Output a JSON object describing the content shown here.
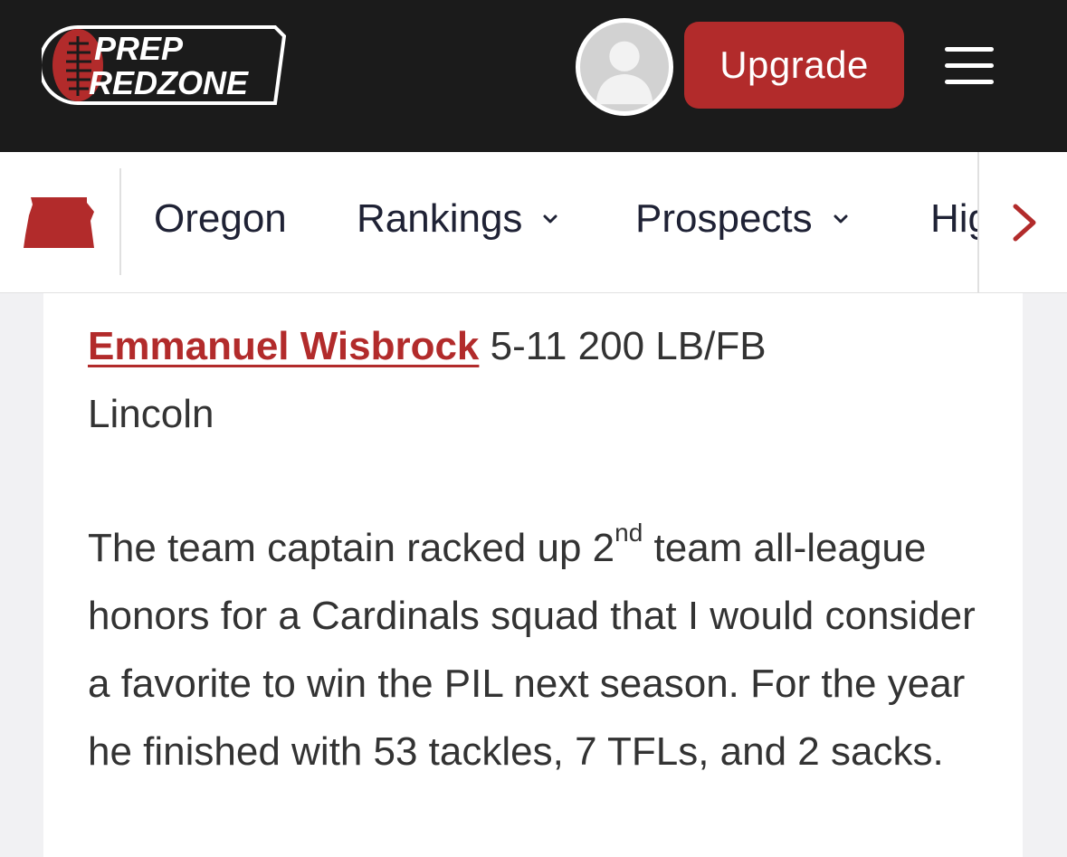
{
  "header": {
    "logo": {
      "line1": "PREP",
      "line2": "REDZONE"
    },
    "upgrade_label": "Upgrade",
    "colors": {
      "background": "#1b1b1b",
      "accent": "#b22b2b"
    }
  },
  "nav": {
    "state_icon": "oregon-state-icon",
    "items": [
      {
        "label": "Oregon",
        "has_dropdown": false
      },
      {
        "label": "Rankings",
        "has_dropdown": true
      },
      {
        "label": "Prospects",
        "has_dropdown": true
      },
      {
        "label": "Hig",
        "has_dropdown": false
      }
    ],
    "next_icon": "chevron-right-icon"
  },
  "article": {
    "player_name": "Emmanuel Wisbrock",
    "player_info": "5-11 200 LB/FB",
    "school": "Lincoln",
    "paragraph": {
      "part1": "The team captain racked up 2",
      "superscript": "nd",
      "part2": " team all-league honors for a Cardinals squad that I would consider a favorite to win the PIL next season. For the year he finished with 53 tackles, 7 TFLs, and 2 sacks."
    }
  }
}
